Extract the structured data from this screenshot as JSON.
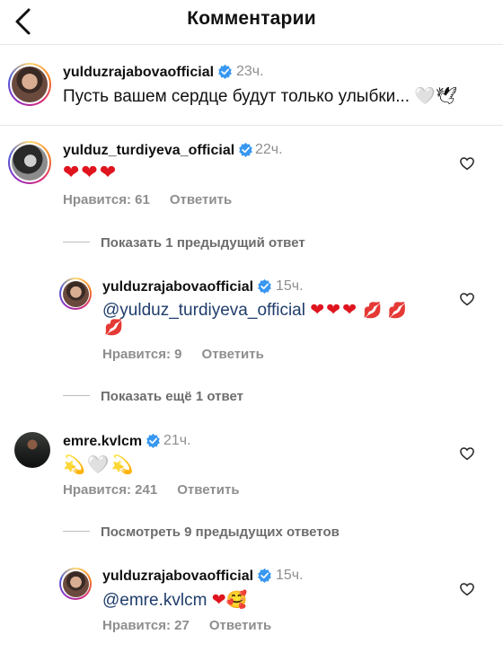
{
  "header": {
    "title": "Комментарии"
  },
  "caption": {
    "username": "yulduzrajabovaofficial",
    "time": "23ч.",
    "text": "Пусть вашем сердце будут только улыбки...",
    "emoji": "🤍🕊"
  },
  "comments": [
    {
      "username": "yulduz_turdiyeva_official",
      "time": "22ч.",
      "text": "❤❤❤",
      "likes": "Нравится: 61",
      "reply": "Ответить"
    },
    {
      "username": "emre.kvlcm",
      "time": "21ч.",
      "text": "💫🤍💫",
      "likes": "Нравится: 241",
      "reply": "Ответить"
    }
  ],
  "threads": {
    "show_prev_1": "Показать 1 предыдущий ответ",
    "show_more_1": "Показать ещё 1 ответ",
    "view_prev_9": "Посмотреть 9 предыдущих ответов"
  },
  "replies": [
    {
      "username": "yulduzrajabovaofficial",
      "time": "15ч.",
      "mention": "@yulduz_turdiyeva_official",
      "hearts": "❤❤❤",
      "kisses": "💋💋",
      "kiss_wrap": "💋",
      "likes": "Нравится: 9",
      "reply": "Ответить"
    },
    {
      "username": "yulduzrajabovaofficial",
      "time": "15ч.",
      "mention": "@emre.kvlcm",
      "emoji": "❤🥰",
      "likes": "Нравится: 27",
      "reply": "Ответить"
    }
  ],
  "colors": {
    "verified": "#3897f0",
    "mention": "#1f3d6b",
    "meta": "#8e8e8e",
    "heart": "#e0141e"
  },
  "icons": [
    "chevron-left-icon",
    "verified-badge-icon",
    "heart-outline-icon"
  ]
}
